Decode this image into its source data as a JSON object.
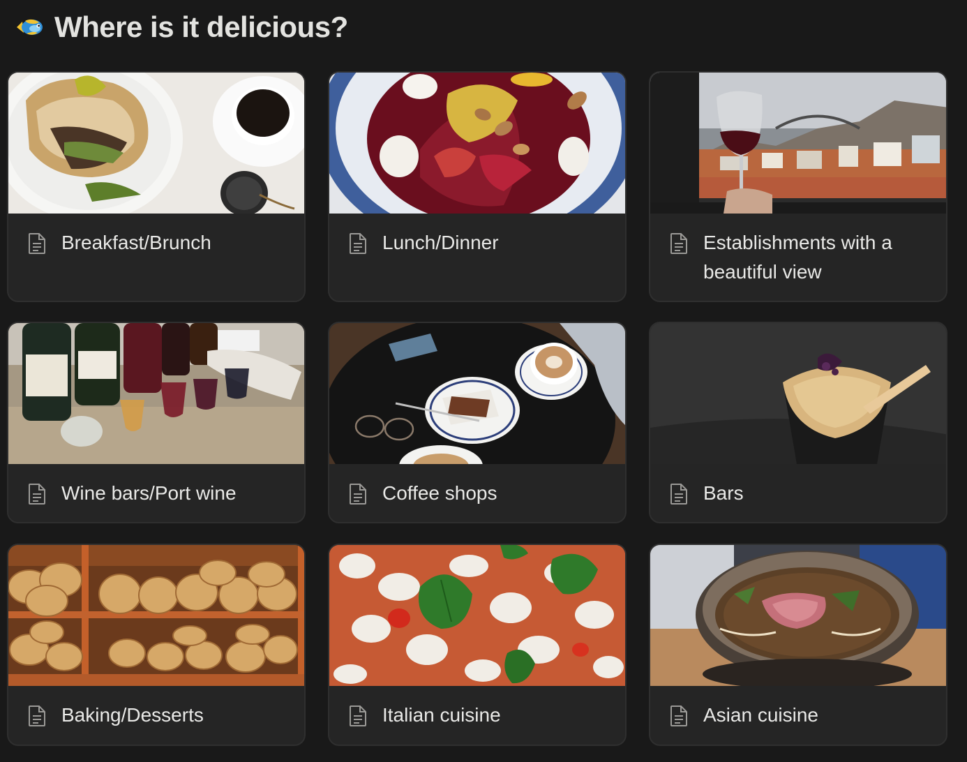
{
  "header": {
    "icon": "tropical-fish-icon",
    "title": "Where is it delicious?"
  },
  "cards": [
    {
      "title": "Breakfast/Brunch",
      "icon": "page-icon",
      "cover": "sandwich-and-coffee-photo"
    },
    {
      "title": "Lunch/Dinner",
      "icon": "page-icon",
      "cover": "beet-salad-photo"
    },
    {
      "title": "Establishments with a beautiful view",
      "icon": "page-icon",
      "cover": "wine-glass-city-view-photo"
    },
    {
      "title": "Wine bars/Port wine",
      "icon": "page-icon",
      "cover": "port-wine-tasting-photo"
    },
    {
      "title": "Coffee shops",
      "icon": "page-icon",
      "cover": "coffee-and-cake-photo"
    },
    {
      "title": "Bars",
      "icon": "page-icon",
      "cover": "cocktail-dessert-photo"
    },
    {
      "title": "Baking/Desserts",
      "icon": "page-icon",
      "cover": "bread-bakery-photo"
    },
    {
      "title": "Italian cuisine",
      "icon": "page-icon",
      "cover": "pizza-photo"
    },
    {
      "title": "Asian cuisine",
      "icon": "page-icon",
      "cover": "pho-bowl-photo"
    }
  ]
}
